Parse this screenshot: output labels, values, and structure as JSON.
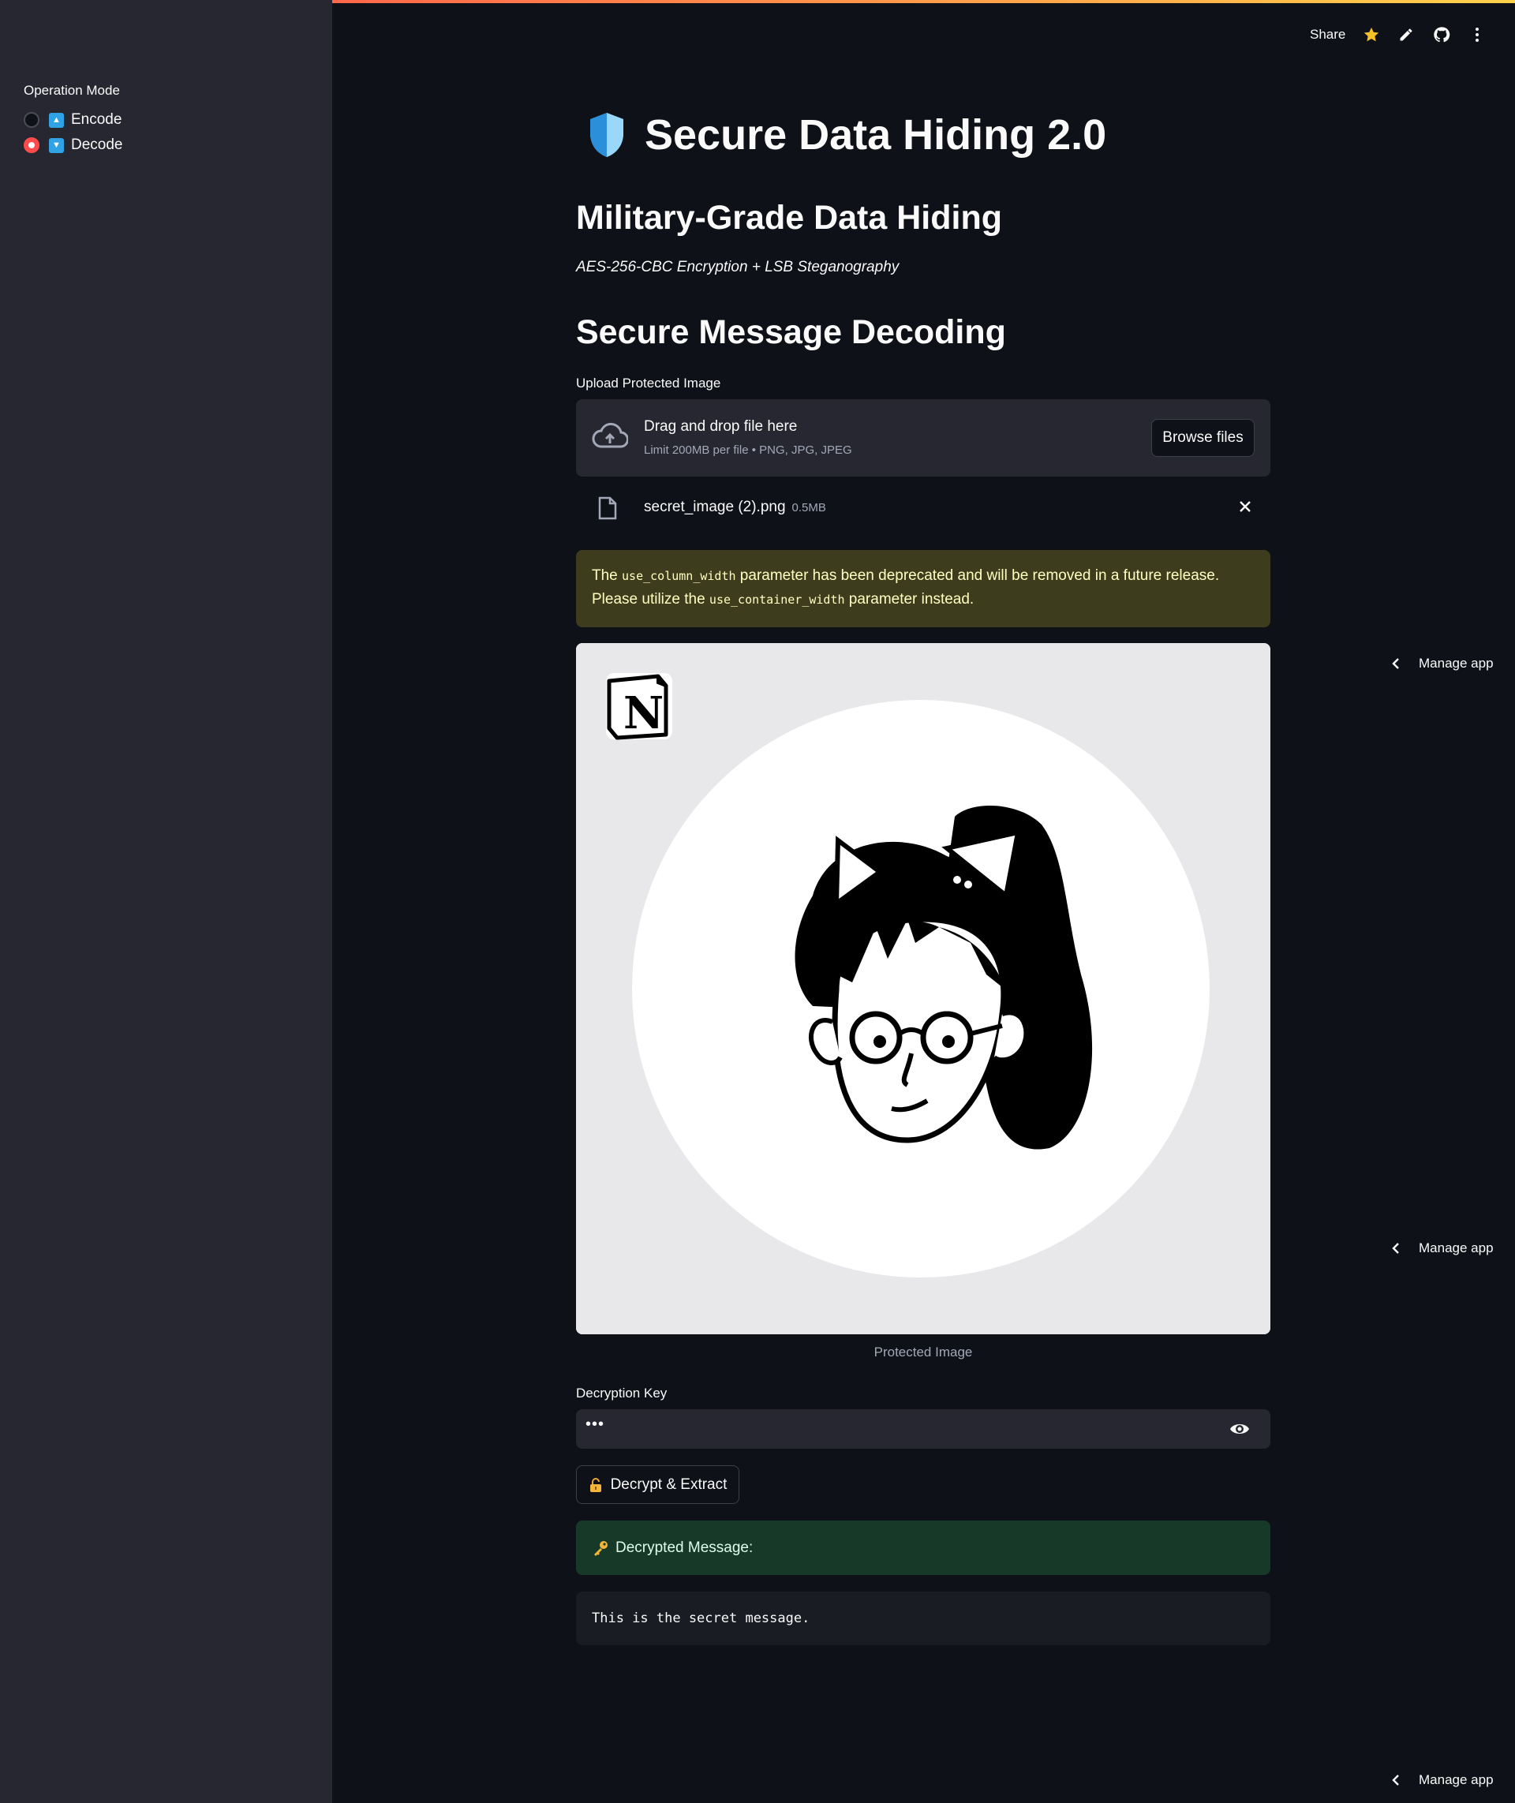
{
  "sidebar": {
    "label": "Operation Mode",
    "options": [
      {
        "label": "Encode",
        "icon": "up-arrow-button-icon",
        "selected": false
      },
      {
        "label": "Decode",
        "icon": "down-arrow-button-icon",
        "selected": true
      }
    ]
  },
  "header": {
    "share_label": "Share"
  },
  "main": {
    "title": "Secure Data Hiding 2.0",
    "heading": "Military-Grade Data Hiding",
    "subtitle": "AES-256-CBC Encryption + LSB Steganography",
    "section_heading": "Secure Message Decoding",
    "upload": {
      "label": "Upload Protected Image",
      "drop_text": "Drag and drop file here",
      "limit_text": "Limit 200MB per file • PNG, JPG, JPEG",
      "browse_label": "Browse files",
      "file_name": "secret_image (2).png",
      "file_size": "0.5MB"
    },
    "warning": {
      "part1": "The ",
      "code1": "use_column_width",
      "part2": " parameter has been deprecated and will be removed in a future release. Please utilize the ",
      "code2": "use_container_width",
      "part3": " parameter instead."
    },
    "image_caption": "Protected Image",
    "key": {
      "label": "Decryption Key",
      "value": "•••"
    },
    "decrypt_label": "Decrypt & Extract",
    "result_label": "Decrypted Message:",
    "result_text": "This is the secret message."
  },
  "manage_app_label": "Manage app",
  "colors": {
    "background": "#0e1117",
    "sidebar": "#262730",
    "accent": "#ff4b4b",
    "warning_bg": "#3d3d1e",
    "success_bg": "#173928"
  }
}
